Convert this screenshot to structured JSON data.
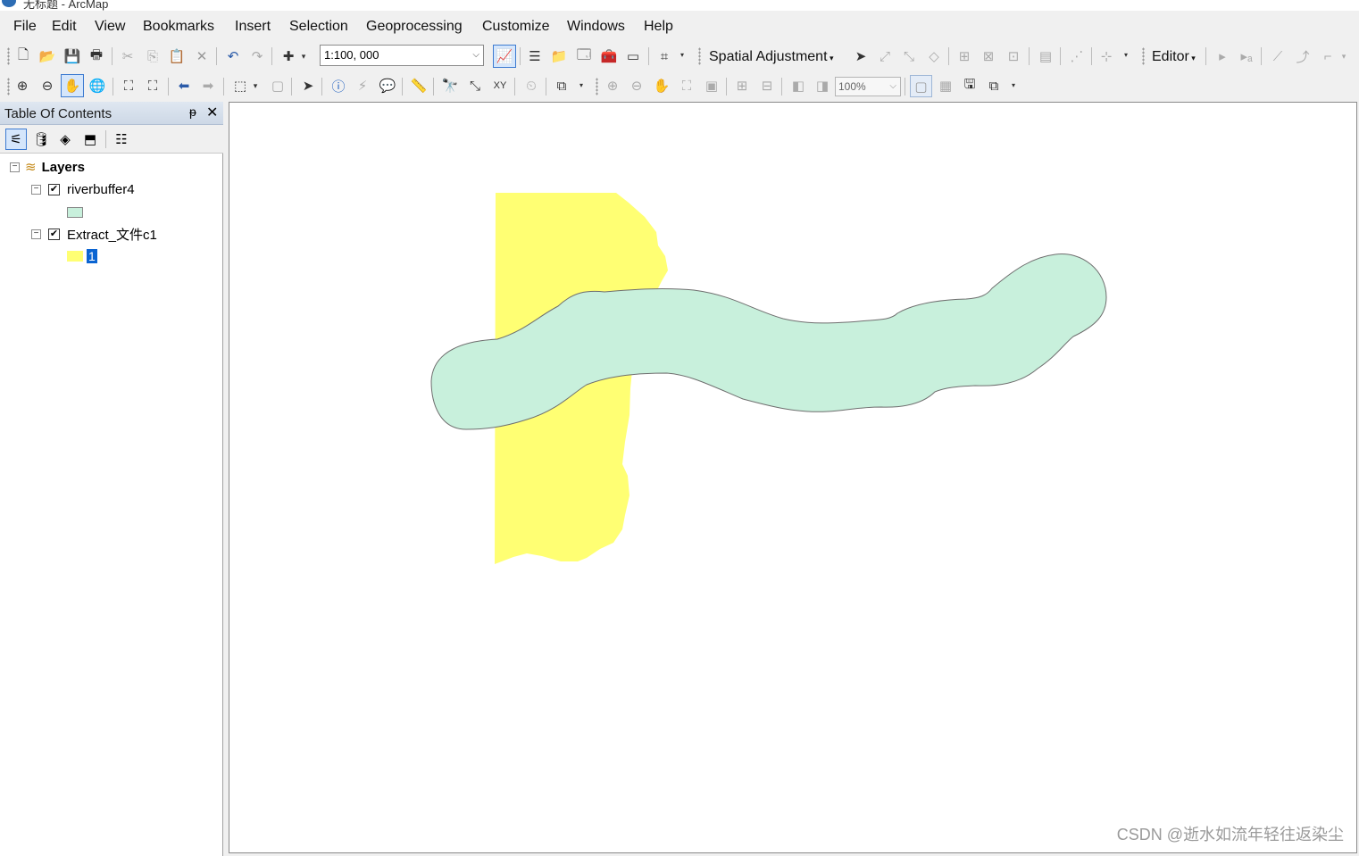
{
  "window": {
    "title": "无标题 - ArcMap"
  },
  "menu": [
    "File",
    "Edit",
    "View",
    "Bookmarks",
    "Insert",
    "Selection",
    "Geoprocessing",
    "Customize",
    "Windows",
    "Help"
  ],
  "standard_toolbar": {
    "scale": "1:100, 000",
    "spatial_adjustment_label": "Spatial Adjustment",
    "editor_label": "Editor"
  },
  "layout_toolbar": {
    "zoom_percent": "100%"
  },
  "toc": {
    "title": "Table Of Contents",
    "pin_glyph": "ᵽ",
    "close_glyph": "✕",
    "root_label": "Layers",
    "layers": [
      {
        "name": "riverbuffer4",
        "checked": true,
        "symbol_color": "#c8f0dc",
        "symbol_label": ""
      },
      {
        "name": "Extract_文件c1",
        "checked": true,
        "symbol_color": "#ffff73",
        "symbol_label": "1"
      }
    ]
  },
  "map": {
    "features": [
      {
        "layer": "Extract_文件c1",
        "fill": "#ffff73"
      },
      {
        "layer": "riverbuffer4",
        "fill": "#c8f0dc",
        "stroke": "#6e6e6e"
      }
    ],
    "watermark": "CSDN @逝水如流年轻往返染尘"
  }
}
